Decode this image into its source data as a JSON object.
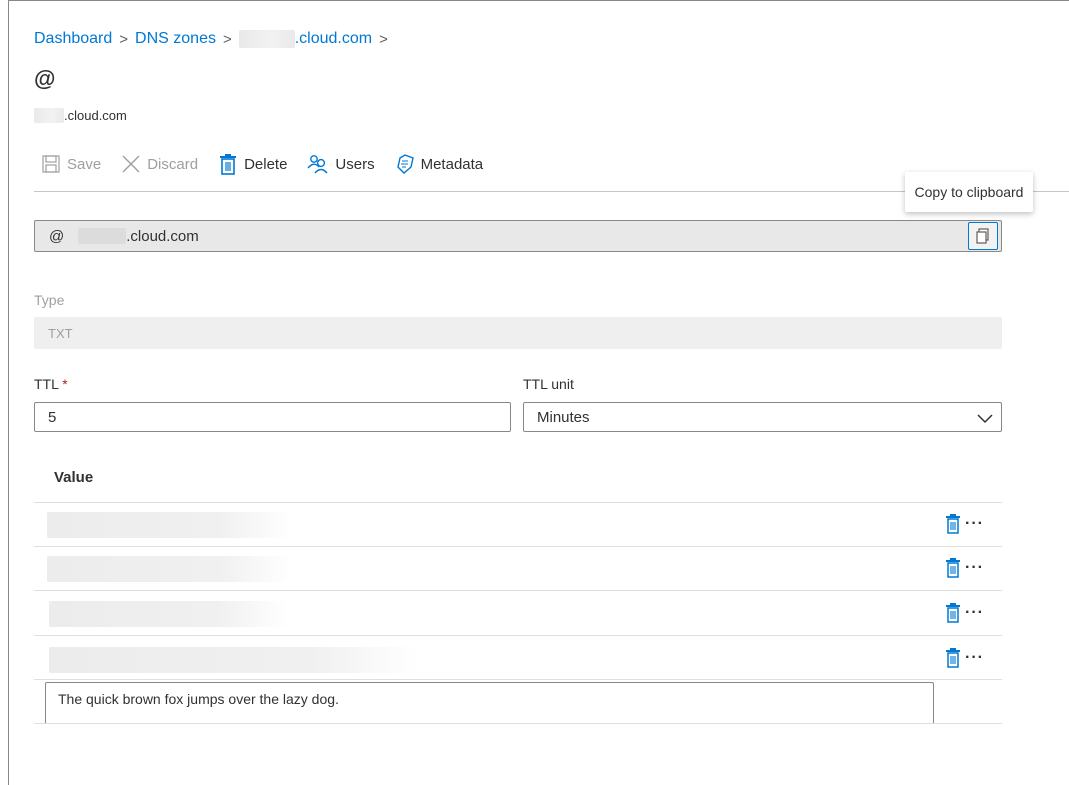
{
  "breadcrumb": {
    "items": [
      "Dashboard",
      "DNS zones"
    ],
    "zone_suffix": ".cloud.com",
    "separator": ">"
  },
  "page": {
    "title": "@",
    "subtitle_suffix": ".cloud.com"
  },
  "toolbar": {
    "save_label": "Save",
    "discard_label": "Discard",
    "delete_label": "Delete",
    "users_label": "Users",
    "metadata_label": "Metadata"
  },
  "tooltip": {
    "text": "Copy to clipboard"
  },
  "record_name": {
    "prefix": "@",
    "suffix": ".cloud.com"
  },
  "type": {
    "label": "Type",
    "value": "TXT"
  },
  "ttl": {
    "label": "TTL",
    "required_marker": "*",
    "value": "5"
  },
  "ttl_unit": {
    "label": "TTL unit",
    "selected": "Minutes"
  },
  "values": {
    "header": "Value",
    "more_label": "···",
    "new_value": "The quick brown fox jumps over the lazy dog."
  },
  "colors": {
    "accent": "#0078d4",
    "required": "#a4262c",
    "disabled": "#a19f9d"
  }
}
